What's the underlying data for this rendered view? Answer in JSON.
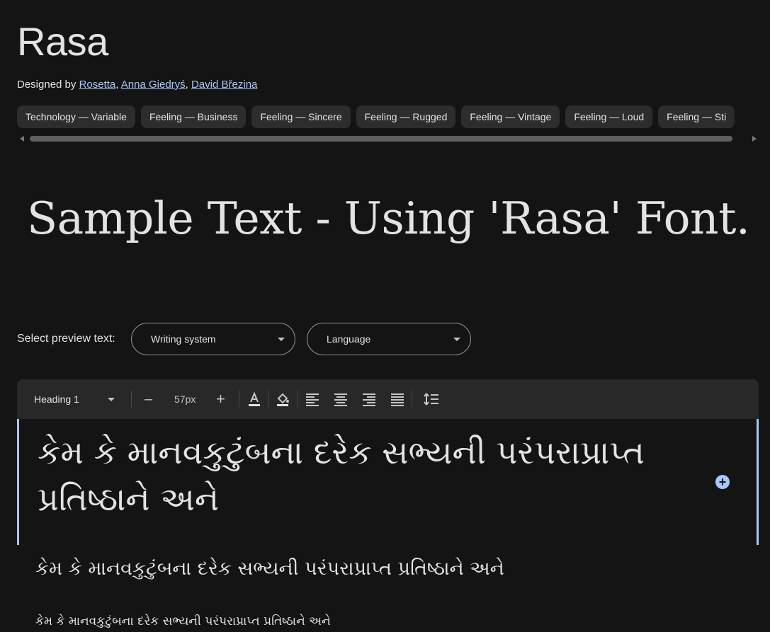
{
  "font": {
    "title": "Rasa",
    "designed_by_label": "Designed by ",
    "designers": [
      "Rosetta",
      "Anna Giedryś",
      "David Březina"
    ],
    "separator": ", "
  },
  "tags": [
    "Technology — Variable",
    "Feeling — Business",
    "Feeling — Sincere",
    "Feeling — Rugged",
    "Feeling — Vintage",
    "Feeling — Loud",
    "Feeling — Sti"
  ],
  "sample_text": "Sample Text - Using 'Rasa' Font.",
  "preview": {
    "label": "Select preview text:",
    "writing_system": "Writing system",
    "language": "Language"
  },
  "toolbar": {
    "style": "Heading 1",
    "size": "57px",
    "minus": "–",
    "plus": "+"
  },
  "preview_lines": {
    "heading": "કેમ કે માનવકુટુંબના દરેક સભ્યની પરંપરાપ્રાપ્ત પ્રતિષ્ઠાને અને",
    "medium": "કેમ કે માનવકુટુંબના દરેક સભ્યની પરંપરાપ્રાપ્ત પ્રતિષ્ઠાને અને",
    "small": "કેમ કે માનવકુટુંબના દરેક સભ્યની પરંપરાપ્રાપ્ત પ્રતિષ્ઠાને અને"
  },
  "colors": {
    "background": "#141414",
    "accent": "#a8c7fa",
    "chip": "#2d2d2d"
  }
}
